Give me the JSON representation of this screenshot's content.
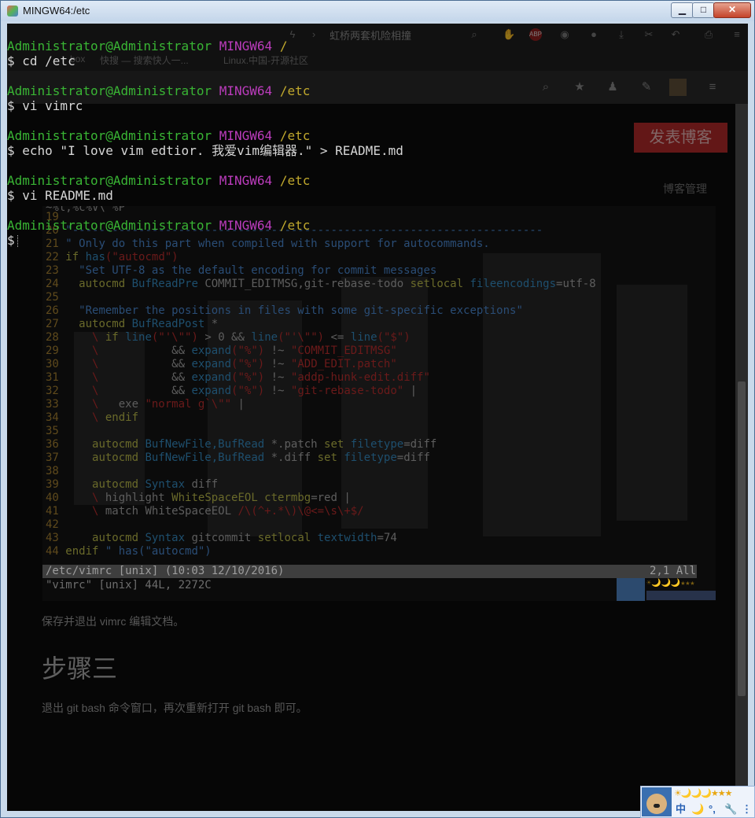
{
  "window": {
    "title": "MINGW64:/etc",
    "controls": {
      "minimize": "▁",
      "maximize": "□",
      "close": "✕"
    }
  },
  "terminal": {
    "lines": [
      {
        "type": "prompt",
        "user": "Administrator@Administrator",
        "host": "MINGW64",
        "path": "/"
      },
      {
        "type": "cmd",
        "text": "$ cd /etc"
      },
      {
        "type": "prompt",
        "user": "Administrator@Administrator",
        "host": "MINGW64",
        "path": "/etc"
      },
      {
        "type": "cmd",
        "text": "$ vi vimrc"
      },
      {
        "type": "prompt",
        "user": "Administrator@Administrator",
        "host": "MINGW64",
        "path": "/etc"
      },
      {
        "type": "cmd",
        "text": "$ echo \"I love vim edtior. 我爱vim编辑器.\" > README.md"
      },
      {
        "type": "prompt",
        "user": "Administrator@Administrator",
        "host": "MINGW64",
        "path": "/etc"
      },
      {
        "type": "cmd",
        "text": "$ vi README.md"
      },
      {
        "type": "prompt",
        "user": "Administrator@Administrator",
        "host": "MINGW64",
        "path": "/etc"
      },
      {
        "type": "cursor",
        "text": "$"
      }
    ]
  },
  "background_page": {
    "address_text": "虹桥两套机险相撞",
    "bookmarks": [
      "box",
      "快搜 — 搜索快人一...",
      "Linux.中国-开源社区"
    ],
    "toolbar_icons": [
      "lightning-icon",
      "chevron-right-icon",
      "search-icon",
      "puzzle-icon",
      "adblock-icon",
      "record-icon",
      "chat-icon",
      "download-icon",
      "scissors-icon",
      "undo-icon",
      "share-icon",
      "menu-icon"
    ],
    "nav_icons": [
      "search-icon",
      "star-icon",
      "bell-icon",
      "edit-icon",
      "avatar",
      "menu-icon"
    ],
    "publish_button": "发表博客",
    "blog_manage": "博客管理",
    "caption": "保存并退出 vimrc 编辑文档。",
    "heading": "步骤三",
    "paragraph": "退出 git bash 命令窗口，再次重新打开 git bash 即可。"
  },
  "vim_screenshot": {
    "top_line": "~%l,%c%V\\ %P",
    "lines": [
      {
        "n": "19",
        "segs": []
      },
      {
        "n": "20",
        "segs": [
          {
            "c": "cmt",
            "t": "\"-----------------------------------------------------------------------"
          }
        ]
      },
      {
        "n": "21",
        "segs": [
          {
            "c": "cmt",
            "t": "\" Only do this part when compiled with support for autocommands."
          }
        ]
      },
      {
        "n": "22",
        "segs": [
          {
            "c": "kw",
            "t": "if "
          },
          {
            "c": "fn",
            "t": "has"
          },
          {
            "c": "str",
            "t": "(\"autocmd\")"
          }
        ]
      },
      {
        "n": "23",
        "segs": [
          {
            "c": "cmt",
            "t": "  \"Set UTF-8 as the default encoding for commit messages"
          }
        ]
      },
      {
        "n": "24",
        "segs": [
          {
            "c": "kw",
            "t": "  autocmd "
          },
          {
            "c": "fn",
            "t": "BufReadPre "
          },
          {
            "c": "tx",
            "t": "COMMIT_EDITMSG,git-rebase-todo "
          },
          {
            "c": "kw",
            "t": "setlocal "
          },
          {
            "c": "fn",
            "t": "fileencodings"
          },
          {
            "c": "tx",
            "t": "=utf-8"
          }
        ]
      },
      {
        "n": "25",
        "segs": []
      },
      {
        "n": "26",
        "segs": [
          {
            "c": "cmt",
            "t": "  \"Remember the positions in files with some git-specific exceptions\""
          }
        ]
      },
      {
        "n": "27",
        "segs": [
          {
            "c": "kw",
            "t": "  autocmd "
          },
          {
            "c": "fn",
            "t": "BufReadPost "
          },
          {
            "c": "tx",
            "t": "*"
          }
        ]
      },
      {
        "n": "28",
        "segs": [
          {
            "c": "str",
            "t": "    \\ "
          },
          {
            "c": "kw",
            "t": "if "
          },
          {
            "c": "fn",
            "t": "line"
          },
          {
            "c": "str",
            "t": "(\"'\\\"\")"
          },
          {
            "c": "tx",
            "t": " > 0 && "
          },
          {
            "c": "fn",
            "t": "line"
          },
          {
            "c": "str",
            "t": "(\"'\\\"\")"
          },
          {
            "c": "tx",
            "t": " <= "
          },
          {
            "c": "fn",
            "t": "line"
          },
          {
            "c": "str",
            "t": "(\"$\")"
          }
        ]
      },
      {
        "n": "29",
        "segs": [
          {
            "c": "str",
            "t": "    \\           "
          },
          {
            "c": "tx",
            "t": "&& "
          },
          {
            "c": "fn",
            "t": "expand"
          },
          {
            "c": "str",
            "t": "(\"%\")"
          },
          {
            "c": "tx",
            "t": " !~ "
          },
          {
            "c": "str",
            "t": "\"COMMIT_EDITMSG\""
          }
        ]
      },
      {
        "n": "30",
        "segs": [
          {
            "c": "str",
            "t": "    \\           "
          },
          {
            "c": "tx",
            "t": "&& "
          },
          {
            "c": "fn",
            "t": "expand"
          },
          {
            "c": "str",
            "t": "(\"%\")"
          },
          {
            "c": "tx",
            "t": " !~ "
          },
          {
            "c": "str",
            "t": "\"ADD_EDIT.patch\""
          }
        ]
      },
      {
        "n": "31",
        "segs": [
          {
            "c": "str",
            "t": "    \\           "
          },
          {
            "c": "tx",
            "t": "&& "
          },
          {
            "c": "fn",
            "t": "expand"
          },
          {
            "c": "str",
            "t": "(\"%\")"
          },
          {
            "c": "tx",
            "t": " !~ "
          },
          {
            "c": "str",
            "t": "\"addp-hunk-edit.diff\""
          }
        ]
      },
      {
        "n": "32",
        "segs": [
          {
            "c": "str",
            "t": "    \\           "
          },
          {
            "c": "tx",
            "t": "&& "
          },
          {
            "c": "fn",
            "t": "expand"
          },
          {
            "c": "str",
            "t": "(\"%\")"
          },
          {
            "c": "tx",
            "t": " !~ "
          },
          {
            "c": "str",
            "t": "\"git-rebase-todo\""
          },
          {
            "c": "tx",
            "t": " |"
          }
        ]
      },
      {
        "n": "33",
        "segs": [
          {
            "c": "str",
            "t": "    \\   "
          },
          {
            "c": "tx",
            "t": "exe "
          },
          {
            "c": "str",
            "t": "\"normal g`\\\"\""
          },
          {
            "c": "tx",
            "t": " |"
          }
        ]
      },
      {
        "n": "34",
        "segs": [
          {
            "c": "str",
            "t": "    \\ "
          },
          {
            "c": "kw",
            "t": "endif"
          }
        ]
      },
      {
        "n": "35",
        "segs": []
      },
      {
        "n": "36",
        "segs": [
          {
            "c": "kw",
            "t": "    autocmd "
          },
          {
            "c": "fn",
            "t": "BufNewFile,BufRead "
          },
          {
            "c": "tx",
            "t": "*.patch "
          },
          {
            "c": "kw",
            "t": "set "
          },
          {
            "c": "fn",
            "t": "filetype"
          },
          {
            "c": "tx",
            "t": "=diff"
          }
        ]
      },
      {
        "n": "37",
        "segs": [
          {
            "c": "kw",
            "t": "    autocmd "
          },
          {
            "c": "fn",
            "t": "BufNewFile,BufRead "
          },
          {
            "c": "tx",
            "t": "*.diff "
          },
          {
            "c": "kw",
            "t": "set "
          },
          {
            "c": "fn",
            "t": "filetype"
          },
          {
            "c": "tx",
            "t": "=diff"
          }
        ]
      },
      {
        "n": "38",
        "segs": []
      },
      {
        "n": "39",
        "segs": [
          {
            "c": "kw",
            "t": "    autocmd "
          },
          {
            "c": "fn",
            "t": "Syntax "
          },
          {
            "c": "tx",
            "t": "diff"
          }
        ]
      },
      {
        "n": "40",
        "segs": [
          {
            "c": "str",
            "t": "    \\ "
          },
          {
            "c": "tx",
            "t": "highlight "
          },
          {
            "c": "kw",
            "t": "WhiteSpaceEOL ctermbg"
          },
          {
            "c": "tx",
            "t": "=red |"
          }
        ]
      },
      {
        "n": "41",
        "segs": [
          {
            "c": "str",
            "t": "    \\ "
          },
          {
            "c": "tx",
            "t": "match WhiteSpaceEOL "
          },
          {
            "c": "str",
            "t": "/\\(^+.*\\)\\@<=\\s\\+$/"
          }
        ]
      },
      {
        "n": "42",
        "segs": []
      },
      {
        "n": "43",
        "segs": [
          {
            "c": "kw",
            "t": "    autocmd "
          },
          {
            "c": "fn",
            "t": "Syntax "
          },
          {
            "c": "tx",
            "t": "gitcommit "
          },
          {
            "c": "kw",
            "t": "setlocal "
          },
          {
            "c": "fn",
            "t": "textwidth"
          },
          {
            "c": "tx",
            "t": "=74"
          }
        ]
      },
      {
        "n": "44",
        "segs": [
          {
            "c": "kw",
            "t": "endif "
          },
          {
            "c": "cmt",
            "t": "\" has(\"autocmd\")"
          }
        ]
      }
    ],
    "status_left": "/etc/vimrc [unix] (10:03 12/10/2016)",
    "status_right": "2,1 All",
    "message": "\"vimrc\" [unix] 44L, 2272C"
  },
  "ime_toolbar": {
    "stars": "☀🌙🌙🌙★★★",
    "buttons": [
      "中",
      "🌙",
      "°,",
      "🔧",
      "⋮"
    ]
  },
  "colors": {
    "prompt_user": "#39b534",
    "prompt_host": "#bb3cbc",
    "prompt_path": "#c1a92d",
    "command_text": "#d6d6d6"
  }
}
